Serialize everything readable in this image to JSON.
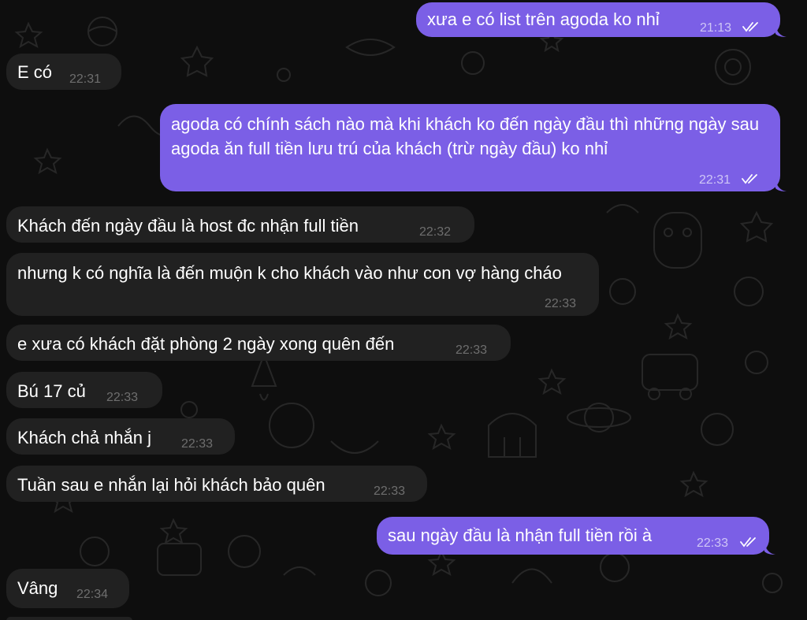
{
  "colors": {
    "background": "#0e0e0e",
    "incoming_bubble": "#212121",
    "outgoing_bubble": "#7b5fe6",
    "incoming_time": "#6e6e6e",
    "outgoing_time": "#cfc6f6"
  },
  "messages": [
    {
      "direction": "out",
      "text": "xưa e có list trên agoda ko nhỉ",
      "time": "21:13",
      "status": "read-double-check-icon"
    },
    {
      "direction": "in",
      "text": "E có",
      "time": "22:31"
    },
    {
      "direction": "out",
      "text": "agoda có chính sách nào mà khi khách ko đến ngày đầu thì những ngày sau agoda ăn full tiền lưu trú của khách (trừ ngày đầu) ko nhỉ",
      "time": "22:31",
      "status": "read-double-check-icon"
    },
    {
      "direction": "in",
      "text": "Khách đến ngày đầu là host đc nhận full tiền",
      "time": "22:32"
    },
    {
      "direction": "in",
      "text": "nhưng k có nghĩa là đến muộn k cho khách vào như con vợ hàng cháo",
      "time": "22:33"
    },
    {
      "direction": "in",
      "text": "e xưa có khách đặt phòng 2 ngày xong quên đến",
      "time": "22:33"
    },
    {
      "direction": "in",
      "text": "Bú 17 củ",
      "time": "22:33"
    },
    {
      "direction": "in",
      "text": "Khách chả nhắn j",
      "time": "22:33"
    },
    {
      "direction": "in",
      "text": "Tuần sau e nhắn lại hỏi khách bảo quên",
      "time": "22:33"
    },
    {
      "direction": "out",
      "text": "sau ngày đầu là nhận full tiền rồi à",
      "time": "22:33",
      "status": "read-double-check-icon"
    },
    {
      "direction": "in",
      "text": "Vâng",
      "time": "22:34"
    }
  ]
}
